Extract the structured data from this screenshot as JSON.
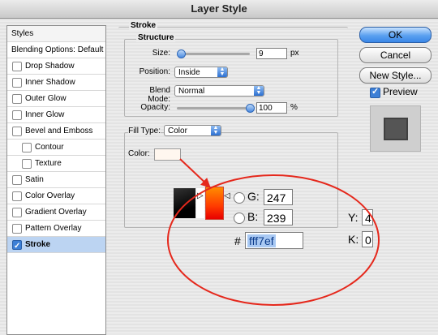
{
  "window": {
    "title": "Layer Style"
  },
  "sidebar": {
    "header": "Styles",
    "items": [
      {
        "label": "Blending Options: Default",
        "checkbox": false,
        "checked": false,
        "indent": 0
      },
      {
        "label": "Drop Shadow",
        "checkbox": true,
        "checked": false,
        "indent": 0
      },
      {
        "label": "Inner Shadow",
        "checkbox": true,
        "checked": false,
        "indent": 0
      },
      {
        "label": "Outer Glow",
        "checkbox": true,
        "checked": false,
        "indent": 0
      },
      {
        "label": "Inner Glow",
        "checkbox": true,
        "checked": false,
        "indent": 0
      },
      {
        "label": "Bevel and Emboss",
        "checkbox": true,
        "checked": false,
        "indent": 0
      },
      {
        "label": "Contour",
        "checkbox": true,
        "checked": false,
        "indent": 1
      },
      {
        "label": "Texture",
        "checkbox": true,
        "checked": false,
        "indent": 1
      },
      {
        "label": "Satin",
        "checkbox": true,
        "checked": false,
        "indent": 0
      },
      {
        "label": "Color Overlay",
        "checkbox": true,
        "checked": false,
        "indent": 0
      },
      {
        "label": "Gradient Overlay",
        "checkbox": true,
        "checked": false,
        "indent": 0
      },
      {
        "label": "Pattern Overlay",
        "checkbox": true,
        "checked": false,
        "indent": 0
      },
      {
        "label": "Stroke",
        "checkbox": true,
        "checked": true,
        "indent": 0,
        "selected": true
      }
    ]
  },
  "stroke": {
    "group_title": "Stroke",
    "structure_title": "Structure",
    "size": {
      "label": "Size:",
      "value": "9",
      "unit": "px"
    },
    "position": {
      "label": "Position:",
      "value": "Inside"
    },
    "blend_mode": {
      "label": "Blend Mode:",
      "value": "Normal"
    },
    "opacity": {
      "label": "Opacity:",
      "value": "100",
      "unit": "%"
    },
    "fill_type": {
      "label": "Fill Type:",
      "value": "Color"
    },
    "color": {
      "label": "Color:",
      "swatch": "#fff7ef"
    }
  },
  "buttons": {
    "ok": "OK",
    "cancel": "Cancel",
    "new_style": "New Style...",
    "preview": "Preview"
  },
  "color_picker": {
    "g_label": "G:",
    "g_value": "247",
    "b_label": "B:",
    "b_value": "239",
    "hash": "#",
    "hex_value": "fff7ef",
    "y_label": "Y:",
    "y_value": "4",
    "k_label": "K:",
    "k_value": "0"
  },
  "colors": {
    "annotation_red": "#e5281c",
    "accent_blue": "#3c7fd6",
    "selection": "#bcd4f2"
  }
}
